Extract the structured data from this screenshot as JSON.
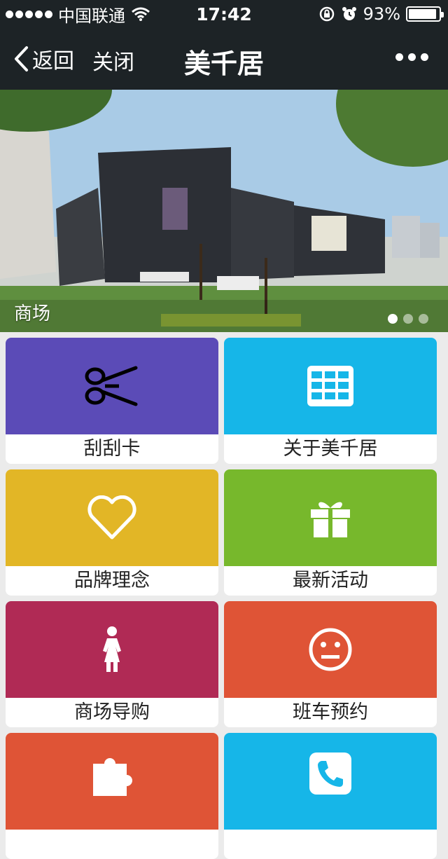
{
  "status": {
    "carrier": "中国联通",
    "time": "17:42",
    "battery": "93%",
    "battery_level": 0.93
  },
  "nav": {
    "back_label": "返回",
    "close_label": "关闭",
    "title": "美千居"
  },
  "banner": {
    "caption": "商场",
    "page_count": 3,
    "active_page": 1
  },
  "tiles": [
    {
      "label": "刮刮卡",
      "icon": "scissors-icon",
      "color": "#5b4bb7"
    },
    {
      "label": "关于美千居",
      "icon": "grid-icon",
      "color": "#16b6e8"
    },
    {
      "label": "品牌理念",
      "icon": "heart-icon",
      "color": "#e2b626"
    },
    {
      "label": "最新活动",
      "icon": "gift-icon",
      "color": "#77b82c"
    },
    {
      "label": "商场导购",
      "icon": "woman-icon",
      "color": "#b02a55"
    },
    {
      "label": "班车预约",
      "icon": "neutral-face-icon",
      "color": "#df5436"
    },
    {
      "label": "",
      "icon": "puzzle-icon",
      "color": "#df5436"
    },
    {
      "label": "",
      "icon": "phone-icon",
      "color": "#16b6e8"
    }
  ]
}
